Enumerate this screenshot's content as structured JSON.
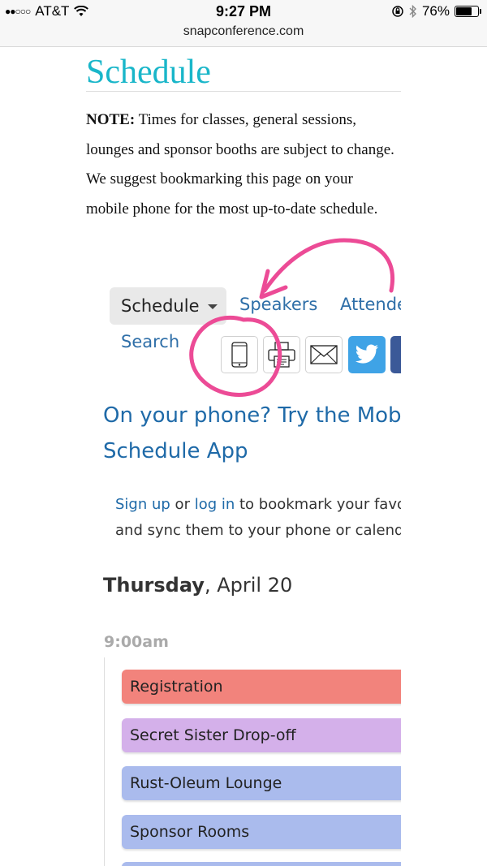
{
  "status_bar": {
    "signal_dots": "●●○○○",
    "carrier": "AT&T",
    "time": "9:27 PM",
    "battery": "76%",
    "battery_level": 0.76,
    "url": "snapconference.com"
  },
  "page": {
    "title": "Schedule",
    "note_label": "NOTE:",
    "note_text": " Times for classes, general sessions, lounges and sponsor booths are subject to change. We suggest bookmarking this page on your mobile phone for the most up-to-date schedule."
  },
  "nav": {
    "schedule": "Schedule",
    "speakers": "Speakers",
    "attendees": "Attendees",
    "search": "Search"
  },
  "tools": [
    "mobile-icon",
    "print-icon",
    "email-icon",
    "twitter-icon",
    "facebook-icon"
  ],
  "mobile_promo": {
    "line1": "On your phone? Try the Mobile",
    "line2": "Schedule App"
  },
  "signup": {
    "sign_up": "Sign up",
    "or": " or ",
    "log_in": "log in",
    "rest1": " to bookmark your favorites",
    "line2": "and sync them to your phone or calendar."
  },
  "day": {
    "weekday": "Thursday",
    "date": ", April 20"
  },
  "time_slot": "9:00am",
  "sessions": [
    {
      "name": "Registration",
      "color": "#f2837c"
    },
    {
      "name": "Secret Sister Drop-off",
      "color": "#d4b0ea"
    },
    {
      "name": "Rust-Oleum Lounge",
      "color": "#aabbed"
    },
    {
      "name": "Sponsor Rooms",
      "color": "#aabbed"
    }
  ],
  "colors": {
    "accent_title": "#19b6c9",
    "link": "#1f6aa8",
    "annotation": "#ec4b96"
  }
}
